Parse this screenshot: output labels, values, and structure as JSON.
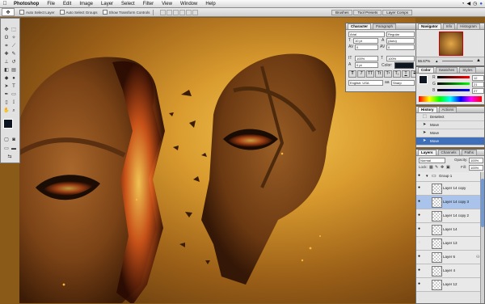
{
  "menubar": {
    "apple": "",
    "items": [
      "Photoshop",
      "File",
      "Edit",
      "Image",
      "Layer",
      "Select",
      "Filter",
      "View",
      "Window",
      "Help"
    ]
  },
  "options": {
    "auto_select_layer": "Auto Select Layer",
    "auto_select_groups": "Auto Select Groups",
    "show_transform": "Show Transform Controls",
    "well_tabs": [
      "Brushes",
      "Tool Presets",
      "Layer Comps"
    ]
  },
  "character": {
    "tabs": [
      "Character",
      "Paragraph"
    ],
    "font_family": "Arial",
    "font_style": "Regular",
    "size": "10 pt",
    "leading": "(Auto)",
    "kerning": "0",
    "tracking": "0",
    "vscale": "100%",
    "hscale": "100%",
    "baseline": "0 pt",
    "color_label": "Color:",
    "styles": [
      "T",
      "T",
      "TT",
      "Tt",
      "T¹",
      "T₁",
      "T",
      "T"
    ],
    "language": "English: USA",
    "aa_label": "aa",
    "aa": "Sharp"
  },
  "navigator": {
    "tabs": [
      "Navigator",
      "Info",
      "Histogram"
    ],
    "zoom": "66.67%"
  },
  "color": {
    "tabs": [
      "Color",
      "Swatches",
      "Styles"
    ],
    "r_label": "R",
    "g_label": "G",
    "b_label": "B",
    "r": "12",
    "g": "21",
    "b": "27"
  },
  "history": {
    "tabs": [
      "History",
      "Actions"
    ],
    "items": [
      {
        "label": "Deselect",
        "sel": false
      },
      {
        "label": "Move",
        "sel": false
      },
      {
        "label": "Move",
        "sel": false
      },
      {
        "label": "Move",
        "sel": true
      }
    ]
  },
  "layers": {
    "tabs": [
      "Layers",
      "Channels",
      "Paths"
    ],
    "blend": "Normal",
    "opacity_label": "Opacity:",
    "opacity": "100%",
    "lock_label": "Lock:",
    "fill_label": "Fill:",
    "fill": "100%",
    "items": [
      {
        "label": "Group 1",
        "type": "group",
        "sel": false
      },
      {
        "label": "Layer 14 copy",
        "type": "layer",
        "sel": false
      },
      {
        "label": "Layer 14 copy 3",
        "type": "layer",
        "sel": true
      },
      {
        "label": "Layer 14 copy 2",
        "type": "layer",
        "sel": false
      },
      {
        "label": "Layer 14",
        "type": "layer",
        "sel": false
      },
      {
        "label": "Layer 13",
        "type": "layer",
        "sel": false
      },
      {
        "label": "Layer 6",
        "type": "layer",
        "sel": false
      },
      {
        "label": "Layer 4",
        "type": "layer",
        "sel": false
      },
      {
        "label": "Layer 12",
        "type": "layer",
        "sel": false
      }
    ]
  }
}
